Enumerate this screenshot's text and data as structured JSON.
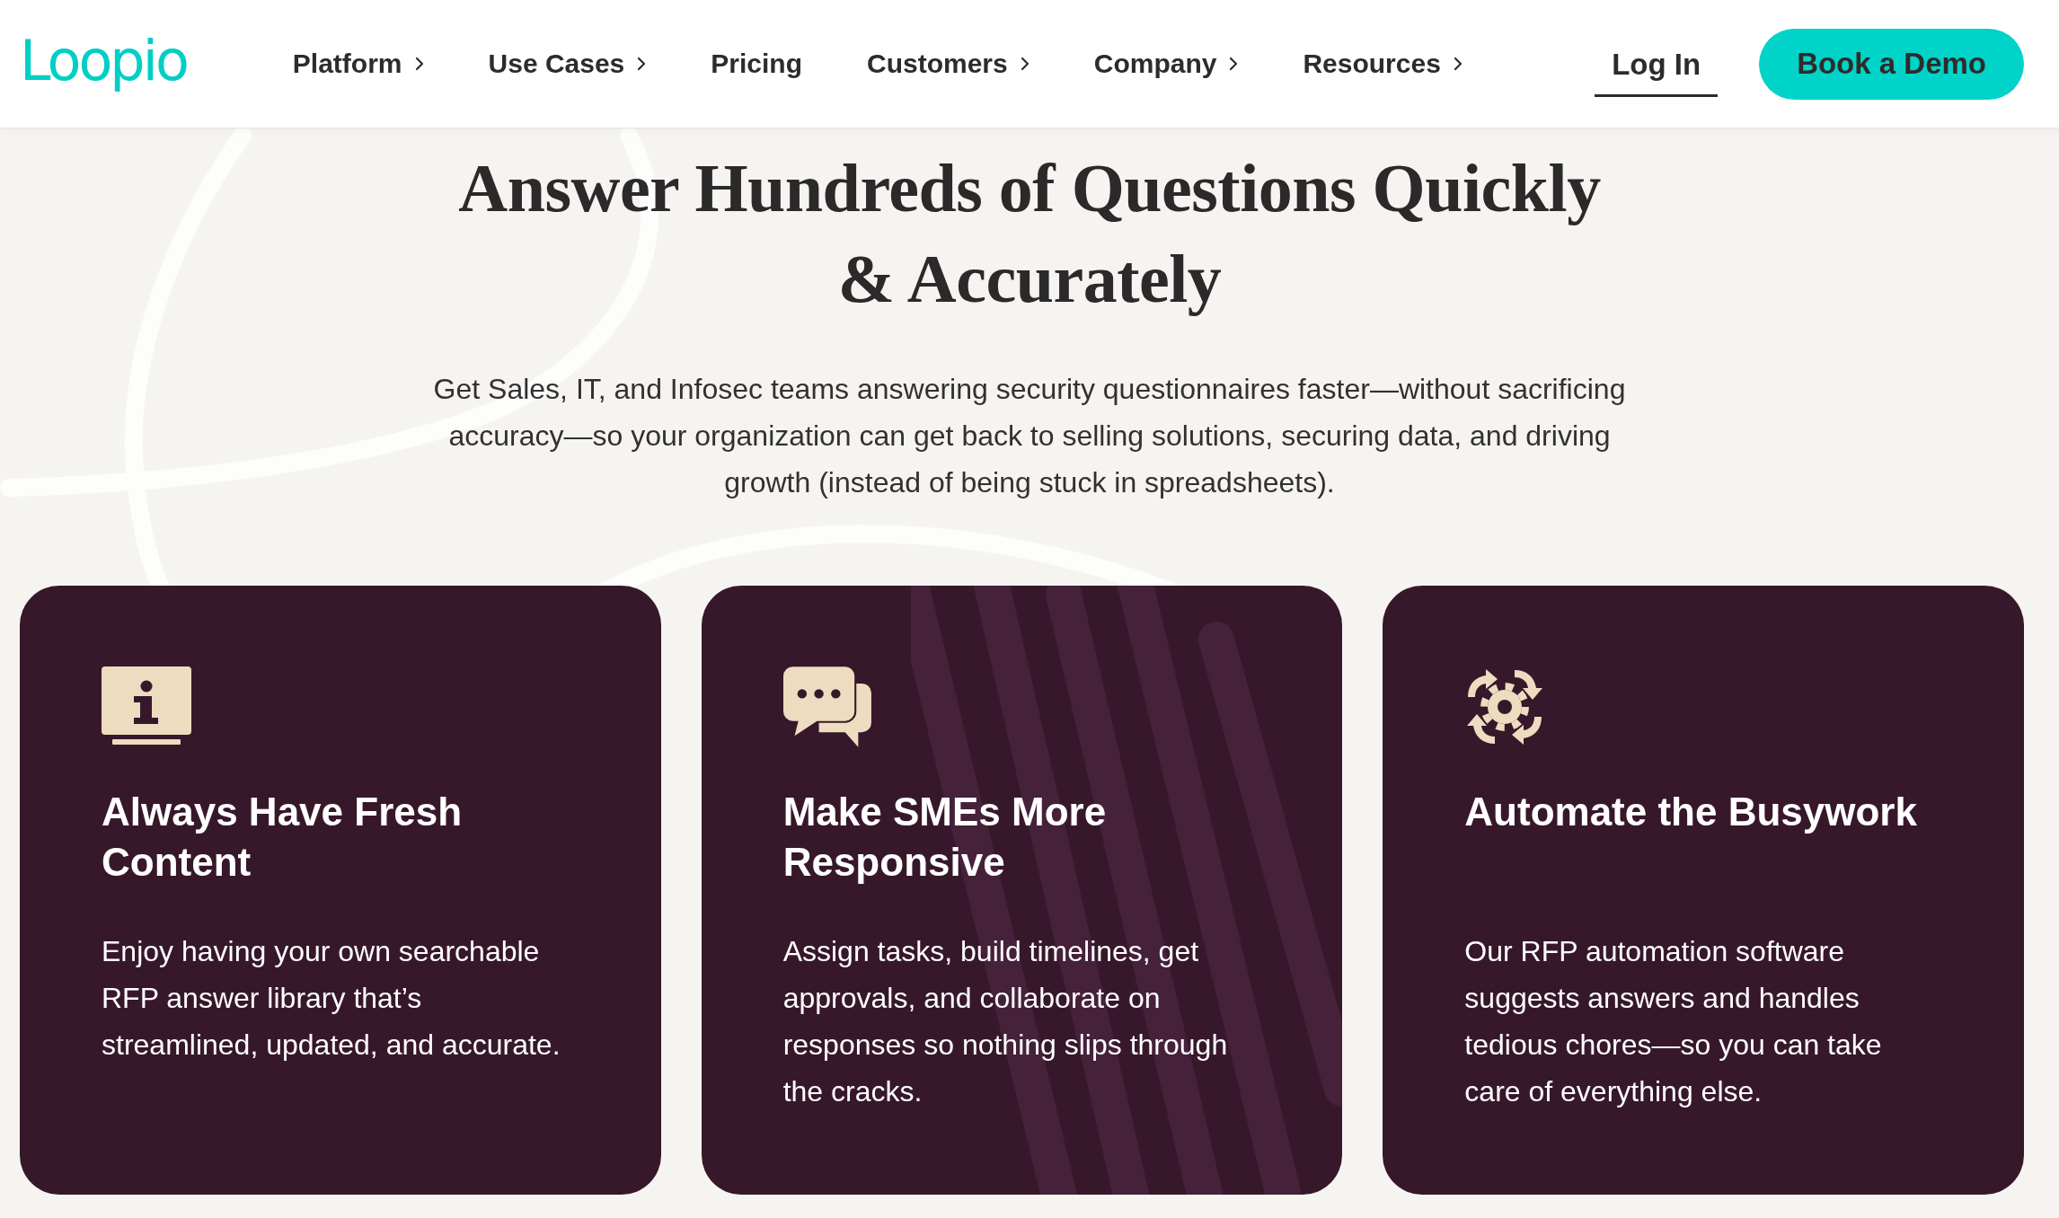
{
  "header": {
    "logo": "Loopio",
    "nav": [
      {
        "label": "Platform",
        "has_submenu": true
      },
      {
        "label": "Use Cases",
        "has_submenu": true
      },
      {
        "label": "Pricing",
        "has_submenu": false
      },
      {
        "label": "Customers",
        "has_submenu": true
      },
      {
        "label": "Company",
        "has_submenu": true
      },
      {
        "label": "Resources",
        "has_submenu": true
      }
    ],
    "login": "Log In",
    "cta": "Book a Demo"
  },
  "hero": {
    "title_lines": [
      "Answer Hundreds of Questions Quickly",
      "& Accurately"
    ],
    "description": "Get Sales, IT, and Infosec teams answering security questionnaires faster—without sacrificing accuracy—so your organization can get back to selling solutions, securing data, and driving growth (instead of being stuck in spreadsheets)."
  },
  "features": [
    {
      "title": "Always Have Fresh Content",
      "text": "Enjoy having your own searchable RFP answer library that’s streamlined, updated, and accurate.",
      "striped": false
    },
    {
      "title": "Make SMEs More Responsive",
      "text": "Assign tasks, build timelines, get approvals, and collaborate on responses so nothing slips through the cracks.",
      "striped": true
    },
    {
      "title": "Automate the Busywork",
      "text": "Our RFP automation software suggests answers and handles tedious chores—so you can take care of everything else.",
      "striped": false
    }
  ]
}
